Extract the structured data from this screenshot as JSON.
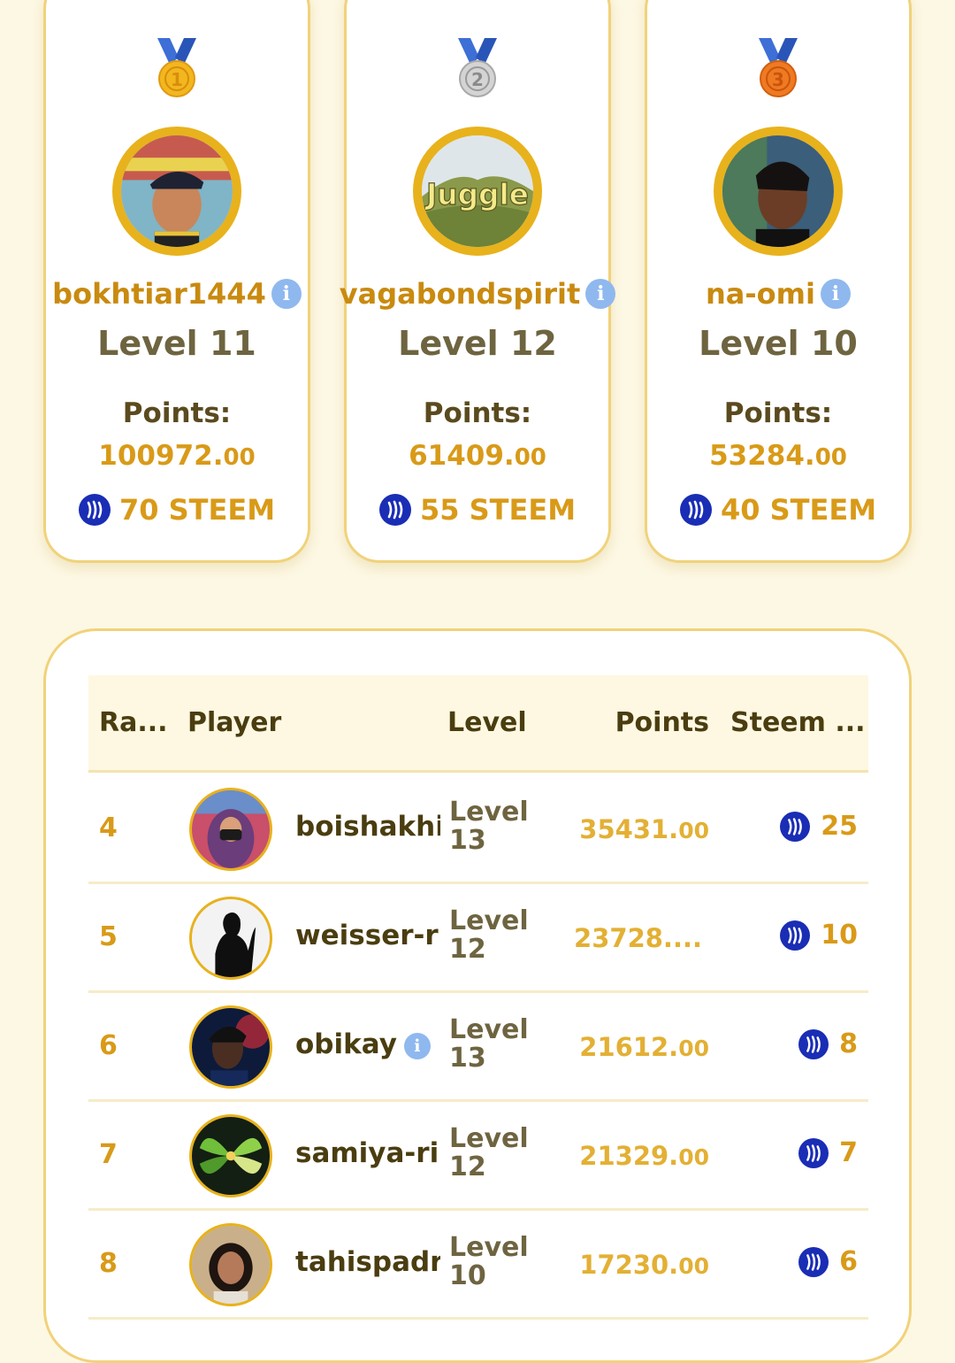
{
  "podium": [
    {
      "rank": "1",
      "name": "bokhtiar1444",
      "has_info": true,
      "level": "Level 11",
      "points_label": "Points:",
      "points_int": "100972.",
      "points_dec": "00",
      "reward": "70 STEEM",
      "medal_color": "#f2b71f",
      "medal_icon": "gold-medal-icon"
    },
    {
      "rank": "2",
      "name": "vagabondspirit",
      "has_info": true,
      "level": "Level 12",
      "points_label": "Points:",
      "points_int": "61409.",
      "points_dec": "00",
      "reward": "55 STEEM",
      "medal_color": "#c9c9c9",
      "medal_icon": "silver-medal-icon",
      "avatar_text": "Juggle"
    },
    {
      "rank": "3",
      "name": "na-omi",
      "has_info": true,
      "level": "Level 10",
      "points_label": "Points:",
      "points_int": "53284.",
      "points_dec": "00",
      "reward": "40 STEEM",
      "medal_color": "#f07a22",
      "medal_icon": "bronze-medal-icon"
    }
  ],
  "table": {
    "headers": {
      "rank": "Ra...",
      "player": "Player",
      "level": "Level",
      "points": "Points",
      "steem": "Steem ..."
    },
    "rows": [
      {
        "rank": "4",
        "name": "boishakhi",
        "has_info": false,
        "level_word": "Level",
        "level_num": "13",
        "points_int": "35431.",
        "points_dec": "00",
        "steem": "25"
      },
      {
        "rank": "5",
        "name": "weisser-r",
        "has_info": false,
        "level_word": "Level",
        "level_num": "12",
        "points_int": "23728....",
        "points_dec": "",
        "steem": "10"
      },
      {
        "rank": "6",
        "name": "obikay",
        "has_info": true,
        "level_word": "Level",
        "level_num": "13",
        "points_int": "21612.",
        "points_dec": "00",
        "steem": "8"
      },
      {
        "rank": "7",
        "name": "samiya-ri",
        "has_info": false,
        "level_word": "Level",
        "level_num": "12",
        "points_int": "21329.",
        "points_dec": "00",
        "steem": "7"
      },
      {
        "rank": "8",
        "name": "tahispadr",
        "has_info": false,
        "level_word": "Level",
        "level_num": "10",
        "points_int": "17230.",
        "points_dec": "00",
        "steem": "6"
      }
    ]
  },
  "icons": {
    "info": "i",
    "steem": "steem-icon",
    "steem_color": "#1a2db5"
  },
  "colors": {
    "background": "#fdf8e4",
    "accent_gold": "#d99a18",
    "card_border": "#f1d27a",
    "avatar_ring": "#e8b21c",
    "info_blue": "#8fb8ef"
  }
}
